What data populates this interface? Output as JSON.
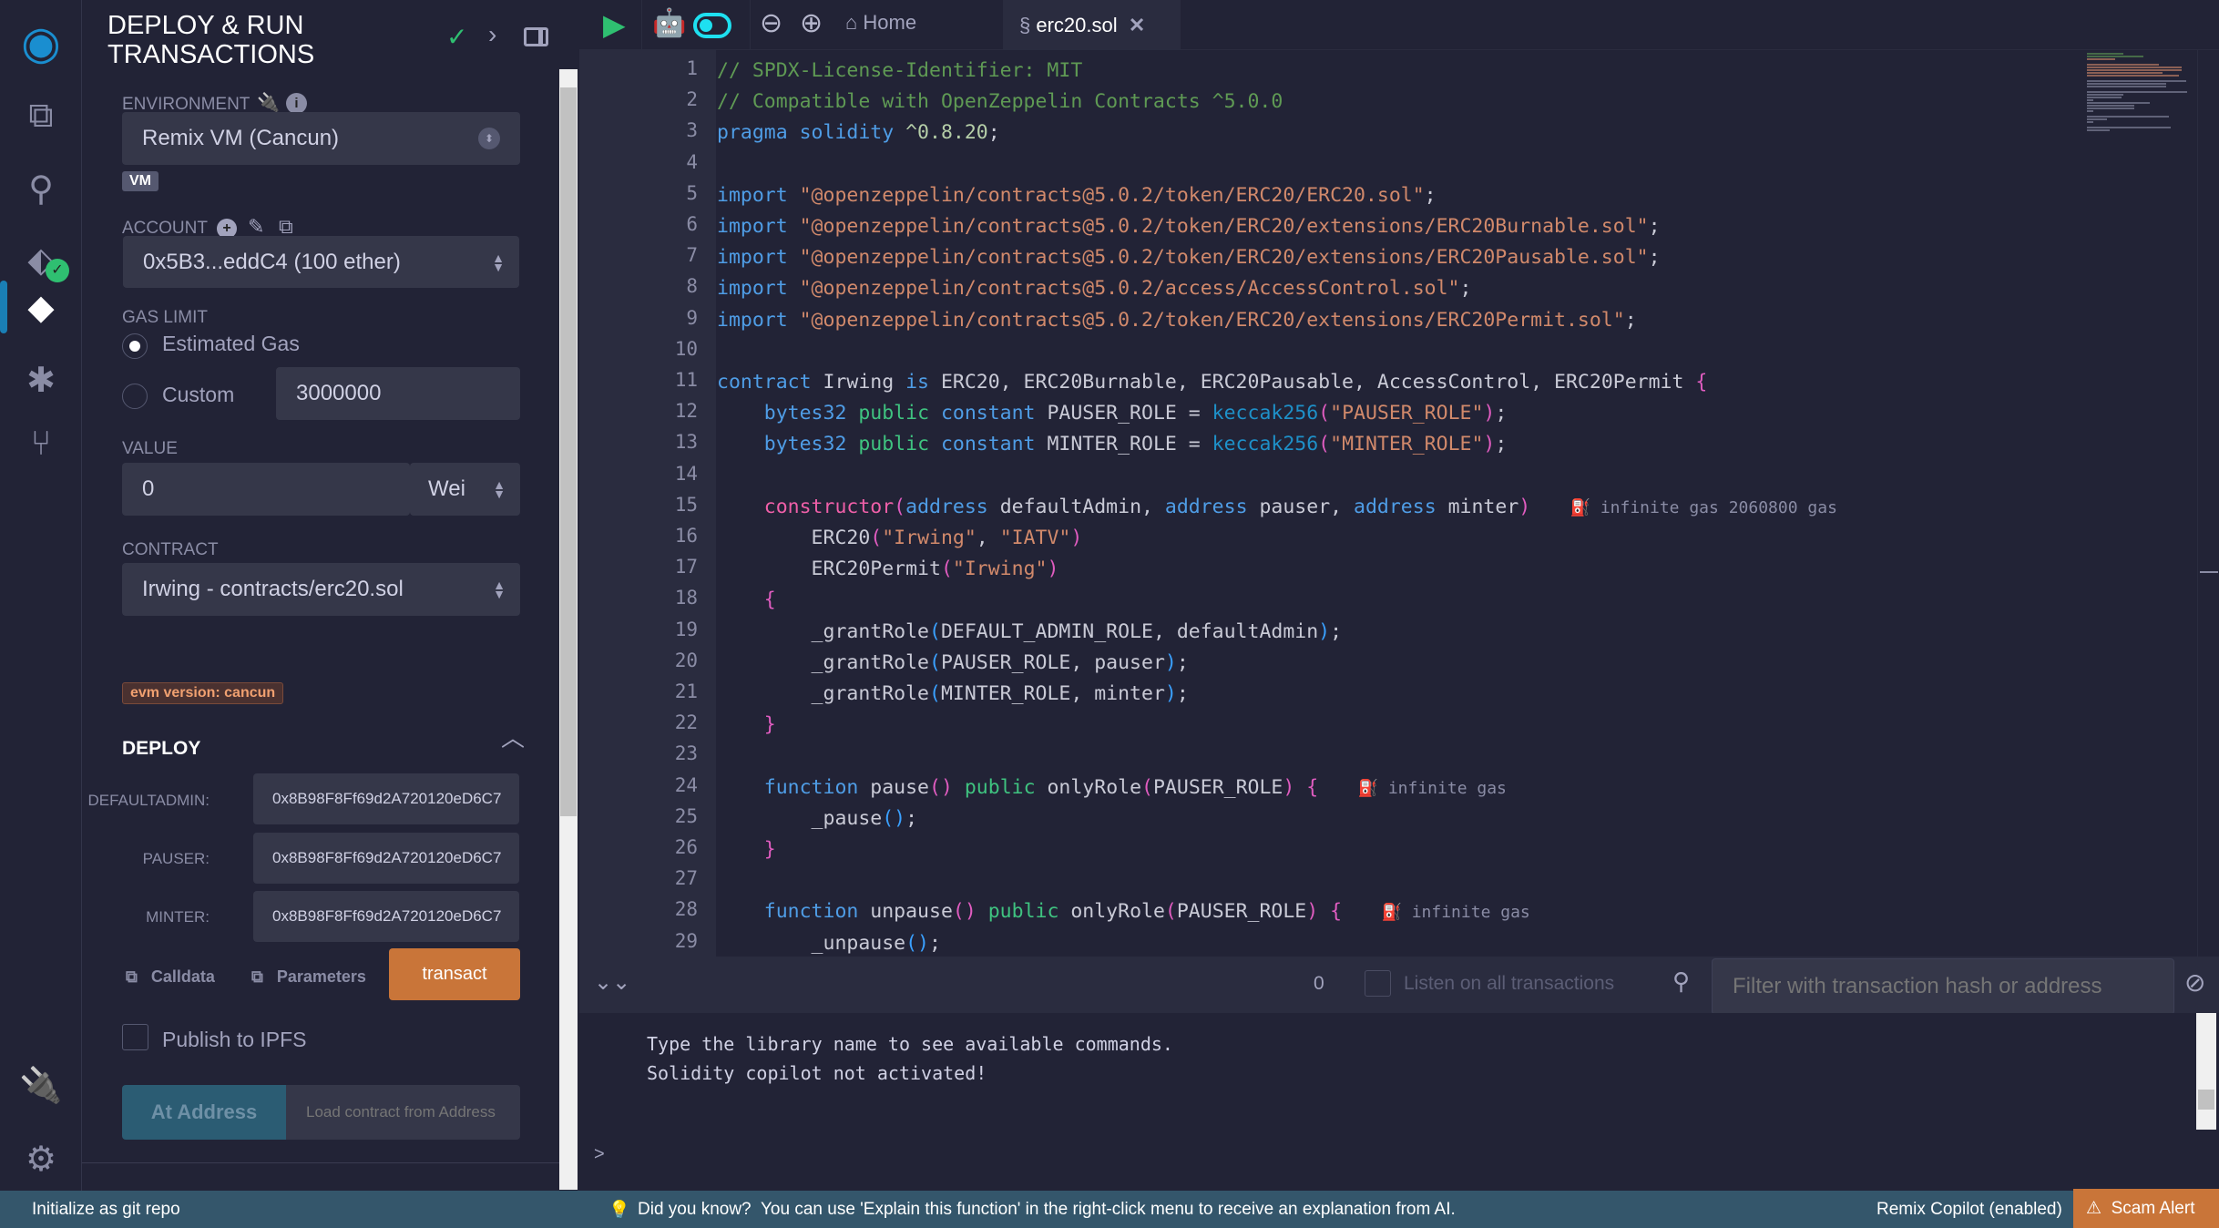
{
  "iconbar": {
    "icons": [
      "remix-logo-icon",
      "file-explorer-icon",
      "search-icon",
      "solidity-compiler-icon",
      "deploy-run-icon",
      "debugger-icon",
      "git-icon",
      "plugin-manager-icon",
      "settings-icon"
    ]
  },
  "panel": {
    "title": "DEPLOY & RUN TRANSACTIONS",
    "environment_label": "ENVIRONMENT",
    "environment_value": "Remix VM (Cancun)",
    "vm_badge": "VM",
    "account_label": "ACCOUNT",
    "account_value": "0x5B3...eddC4 (100 ether)",
    "gas_limit_label": "GAS LIMIT",
    "gas_estimated": "Estimated Gas",
    "gas_custom": "Custom",
    "gas_custom_value": "3000000",
    "value_label": "VALUE",
    "value_amount": "0",
    "value_unit": "Wei",
    "contract_label": "CONTRACT",
    "contract_value": "Irwing - contracts/erc20.sol",
    "evm_badge": "evm version: cancun",
    "deploy_label": "DEPLOY",
    "params": [
      {
        "label": "DEFAULTADMIN:",
        "value": "0x8B98F8Ff69d2A720120eD6C7"
      },
      {
        "label": "PAUSER:",
        "value": "0x8B98F8Ff69d2A720120eD6C7"
      },
      {
        "label": "MINTER:",
        "value": "0x8B98F8Ff69d2A720120eD6C7"
      }
    ],
    "calldata": "Calldata",
    "parameters": "Parameters",
    "transact": "transact",
    "publish_ipfs": "Publish to IPFS",
    "at_address": "At Address",
    "load_placeholder": "Load contract from Address"
  },
  "tabs": {
    "home": "Home",
    "file": "erc20.sol"
  },
  "code": [
    [
      [
        "c-cm",
        "// SPDX-License-Identifier: MIT"
      ]
    ],
    [
      [
        "c-cm",
        "// Compatible with OpenZeppelin Contracts ^5.0.0"
      ]
    ],
    [
      [
        "c-kw",
        "pragma solidity "
      ],
      [
        "c-num",
        "^0.8.20"
      ],
      [
        "c-id",
        ";"
      ]
    ],
    [],
    [
      [
        "c-kw",
        "import "
      ],
      [
        "c-st",
        "\"@openzeppelin/contracts@5.0.2/token/ERC20/ERC20.sol\""
      ],
      [
        "c-id",
        ";"
      ]
    ],
    [
      [
        "c-kw",
        "import "
      ],
      [
        "c-st",
        "\"@openzeppelin/contracts@5.0.2/token/ERC20/extensions/ERC20Burnable.sol\""
      ],
      [
        "c-id",
        ";"
      ]
    ],
    [
      [
        "c-kw",
        "import "
      ],
      [
        "c-st",
        "\"@openzeppelin/contracts@5.0.2/token/ERC20/extensions/ERC20Pausable.sol\""
      ],
      [
        "c-id",
        ";"
      ]
    ],
    [
      [
        "c-kw",
        "import "
      ],
      [
        "c-st",
        "\"@openzeppelin/contracts@5.0.2/access/AccessControl.sol\""
      ],
      [
        "c-id",
        ";"
      ]
    ],
    [
      [
        "c-kw",
        "import "
      ],
      [
        "c-st",
        "\"@openzeppelin/contracts@5.0.2/token/ERC20/extensions/ERC20Permit.sol\""
      ],
      [
        "c-id",
        ";"
      ]
    ],
    [],
    [
      [
        "c-kw",
        "contract "
      ],
      [
        "c-id",
        "Irwing "
      ],
      [
        "c-kw",
        "is "
      ],
      [
        "c-id",
        "ERC20, ERC20Burnable, ERC20Pausable, AccessControl, ERC20Permit "
      ],
      [
        "c-pp",
        "{"
      ]
    ],
    [
      [
        "c-id",
        "    "
      ],
      [
        "c-kw",
        "bytes32 "
      ],
      [
        "c-pub",
        "public "
      ],
      [
        "c-kw",
        "constant "
      ],
      [
        "c-id",
        "PAUSER_ROLE = "
      ],
      [
        "c-fn",
        "keccak256"
      ],
      [
        "c-pp",
        "("
      ],
      [
        "c-st",
        "\"PAUSER_ROLE\""
      ],
      [
        "c-pp",
        ")"
      ],
      [
        "c-id",
        ";"
      ]
    ],
    [
      [
        "c-id",
        "    "
      ],
      [
        "c-kw",
        "bytes32 "
      ],
      [
        "c-pub",
        "public "
      ],
      [
        "c-kw",
        "constant "
      ],
      [
        "c-id",
        "MINTER_ROLE = "
      ],
      [
        "c-fn",
        "keccak256"
      ],
      [
        "c-pp",
        "("
      ],
      [
        "c-st",
        "\"MINTER_ROLE\""
      ],
      [
        "c-pp",
        ")"
      ],
      [
        "c-id",
        ";"
      ]
    ],
    [],
    [
      [
        "c-id",
        "    "
      ],
      [
        "c-ctor",
        "constructor"
      ],
      [
        "c-pp",
        "("
      ],
      [
        "c-kw",
        "address "
      ],
      [
        "c-id",
        "defaultAdmin, "
      ],
      [
        "c-kw",
        "address "
      ],
      [
        "c-id",
        "pauser, "
      ],
      [
        "c-kw",
        "address "
      ],
      [
        "c-id",
        "minter"
      ],
      [
        "c-pp",
        ")"
      ],
      [
        "c-gas",
        "    ⛽ infinite gas 2060800 gas"
      ]
    ],
    [
      [
        "c-id",
        "        ERC20"
      ],
      [
        "c-pp",
        "("
      ],
      [
        "c-st",
        "\"Irwing\""
      ],
      [
        "c-id",
        ", "
      ],
      [
        "c-st",
        "\"IATV\""
      ],
      [
        "c-pp",
        ")"
      ]
    ],
    [
      [
        "c-id",
        "        ERC20Permit"
      ],
      [
        "c-pp",
        "("
      ],
      [
        "c-st",
        "\"Irwing\""
      ],
      [
        "c-pp",
        ")"
      ]
    ],
    [
      [
        "c-id",
        "    "
      ],
      [
        "c-pp",
        "{"
      ]
    ],
    [
      [
        "c-id",
        "        _grantRole"
      ],
      [
        "c-pb",
        "("
      ],
      [
        "c-id",
        "DEFAULT_ADMIN_ROLE, defaultAdmin"
      ],
      [
        "c-pb",
        ")"
      ],
      [
        "c-id",
        ";"
      ]
    ],
    [
      [
        "c-id",
        "        _grantRole"
      ],
      [
        "c-pb",
        "("
      ],
      [
        "c-id",
        "PAUSER_ROLE, pauser"
      ],
      [
        "c-pb",
        ")"
      ],
      [
        "c-id",
        ";"
      ]
    ],
    [
      [
        "c-id",
        "        _grantRole"
      ],
      [
        "c-pb",
        "("
      ],
      [
        "c-id",
        "MINTER_ROLE, minter"
      ],
      [
        "c-pb",
        ")"
      ],
      [
        "c-id",
        ";"
      ]
    ],
    [
      [
        "c-id",
        "    "
      ],
      [
        "c-pp",
        "}"
      ]
    ],
    [],
    [
      [
        "c-id",
        "    "
      ],
      [
        "c-kw",
        "function "
      ],
      [
        "c-id",
        "pause"
      ],
      [
        "c-pp",
        "()"
      ],
      [
        "c-id",
        " "
      ],
      [
        "c-pub",
        "public "
      ],
      [
        "c-id",
        "onlyRole"
      ],
      [
        "c-pp",
        "("
      ],
      [
        "c-id",
        "PAUSER_ROLE"
      ],
      [
        "c-pp",
        ")"
      ],
      [
        "c-id",
        " "
      ],
      [
        "c-pp",
        "{"
      ],
      [
        "c-gas",
        "    ⛽ infinite gas"
      ]
    ],
    [
      [
        "c-id",
        "        _pause"
      ],
      [
        "c-pb",
        "()"
      ],
      [
        "c-id",
        ";"
      ]
    ],
    [
      [
        "c-id",
        "    "
      ],
      [
        "c-pp",
        "}"
      ]
    ],
    [],
    [
      [
        "c-id",
        "    "
      ],
      [
        "c-kw",
        "function "
      ],
      [
        "c-id",
        "unpause"
      ],
      [
        "c-pp",
        "()"
      ],
      [
        "c-id",
        " "
      ],
      [
        "c-pub",
        "public "
      ],
      [
        "c-id",
        "onlyRole"
      ],
      [
        "c-pp",
        "("
      ],
      [
        "c-id",
        "PAUSER_ROLE"
      ],
      [
        "c-pp",
        ")"
      ],
      [
        "c-id",
        " "
      ],
      [
        "c-pp",
        "{"
      ],
      [
        "c-gas",
        "    ⛽ infinite gas"
      ]
    ],
    [
      [
        "c-id",
        "        _unpause"
      ],
      [
        "c-pb",
        "()"
      ],
      [
        "c-id",
        ";"
      ]
    ]
  ],
  "terminal": {
    "count": "0",
    "listen_label": "Listen on all transactions",
    "filter_placeholder": "Filter with transaction hash or address",
    "lines": [
      "Type the library name to see available commands.",
      "Solidity copilot not activated!"
    ],
    "prompt": ">"
  },
  "status": {
    "git": "Initialize as git repo",
    "tip_title": "Did you know?",
    "tip": "You can use 'Explain this function' in the right-click menu to receive an explanation from AI.",
    "copilot": "Remix Copilot (enabled)",
    "scam": "Scam Alert"
  },
  "colors": {
    "accent": "#c97539",
    "status_bar": "#34566b",
    "run": "#2fbf71",
    "cyan": "#1ee0f0"
  }
}
